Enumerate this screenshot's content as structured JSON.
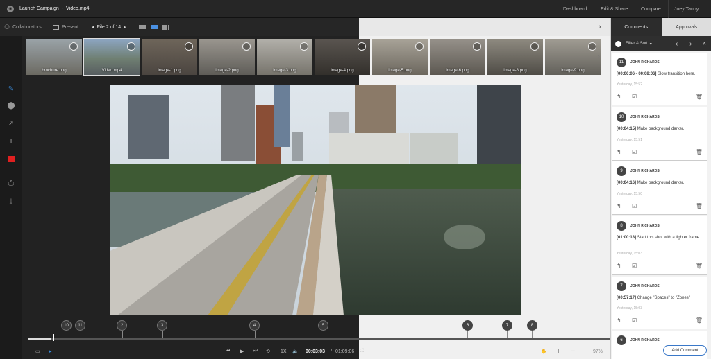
{
  "topbar": {
    "breadcrumb_project": "Launch Campaign",
    "breadcrumb_sep": "-",
    "breadcrumb_file": "Video.mp4",
    "nav": [
      "Dashboard",
      "Edit & Share",
      "Compare"
    ],
    "user": "Joey Tanny"
  },
  "subbar": {
    "collaborators": "Collaborators",
    "present": "Present",
    "file_counter": "File 2 of 14"
  },
  "thumbnails": [
    {
      "label": "brochure.png"
    },
    {
      "label": "Video.mp4"
    },
    {
      "label": "image-1.png"
    },
    {
      "label": "image-2.png"
    },
    {
      "label": "image-3.png"
    },
    {
      "label": "image-4.png"
    },
    {
      "label": "image-5.png"
    },
    {
      "label": "image-6.png"
    },
    {
      "label": "image-8.png"
    },
    {
      "label": "image-9.png"
    }
  ],
  "timeline": {
    "markers": [
      "10",
      "11",
      "2",
      "3",
      "4",
      "5",
      "6",
      "7",
      "8"
    ],
    "current_time": "00:03:03",
    "duration_sep": "/",
    "duration": "01:09:06",
    "speed": "1X",
    "zoom": "97%",
    "progress": 0.04
  },
  "panel": {
    "tabs": [
      "Comments",
      "Approvals"
    ],
    "filter_label": "Filter & Sort",
    "add_comment": "Add Comment",
    "comments": [
      {
        "num": "11",
        "author": "JOHN RICHARDS",
        "timecode": "[00:06:06 - 00:08:06]",
        "text": "Slow transition here.",
        "time": "Yesterday, 15:52"
      },
      {
        "num": "10",
        "author": "JOHN RICHARDS",
        "timecode": "[00:04:15]",
        "text": "Make background darker.",
        "time": "Yesterday, 15:51"
      },
      {
        "num": "9",
        "author": "JOHN RICHARDS",
        "timecode": "[00:04:16]",
        "text": "Make background darker.",
        "time": "Yesterday, 15:50"
      },
      {
        "num": "8",
        "author": "JOHN RICHARDS",
        "timecode": "[01:00:18]",
        "text": "Start this shot with a tighter frame.",
        "time": "Yesterday, 15:03"
      },
      {
        "num": "7",
        "author": "JOHN RICHARDS",
        "timecode": "[00:57:17]",
        "text": "Change \"Spaces\" to \"Zones\"",
        "time": "Yesterday, 15:03"
      },
      {
        "num": "6",
        "author": "JOHN RICHARDS",
        "timecode": "",
        "text": "",
        "time": ""
      }
    ]
  }
}
